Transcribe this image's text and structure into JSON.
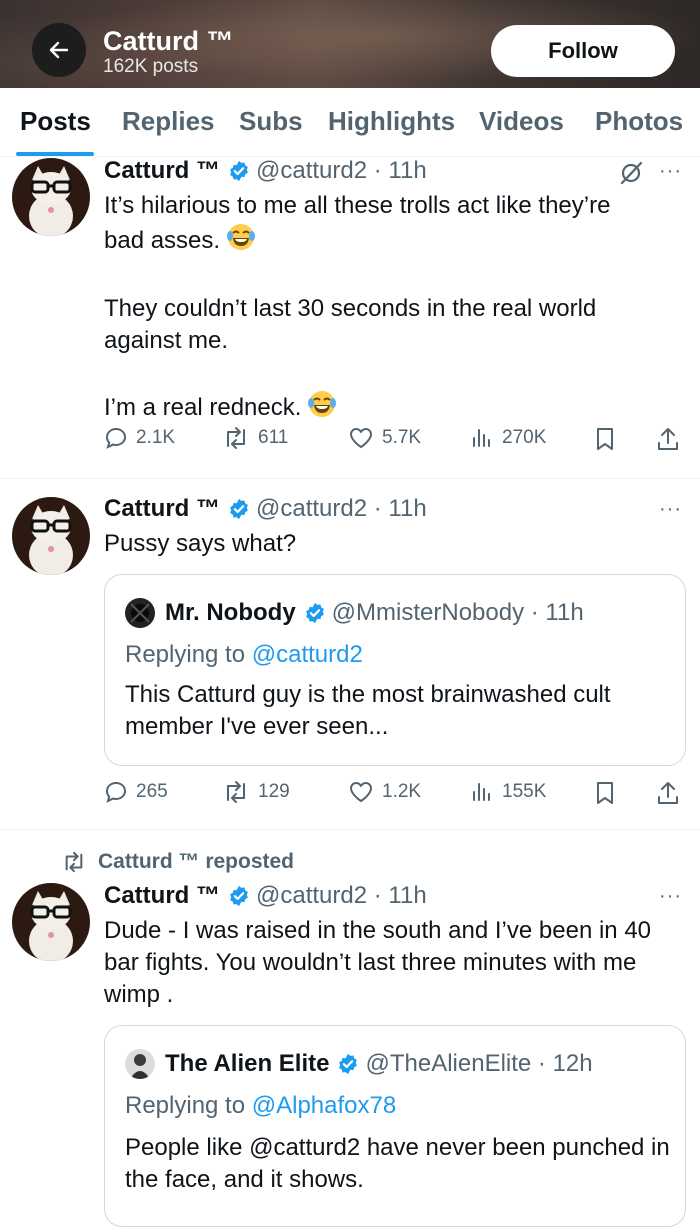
{
  "header": {
    "title": "Catturd ™",
    "post_count": "162K posts",
    "follow_label": "Follow"
  },
  "tabs": [
    "Posts",
    "Replies",
    "Subs",
    "Highlights",
    "Videos",
    "Photos"
  ],
  "active_tab": "Posts",
  "posts": [
    {
      "name": "Catturd ™",
      "handle": "@catturd2 · 11h",
      "body_lines": [
        "It’s hilarious to me all these trolls act like they’re",
        "bad asses.",
        "They couldn’t last 30 seconds in the real world",
        "against me.",
        "I’m a real redneck."
      ],
      "emoji": "😂",
      "replies": "2.1K",
      "reposts": "611",
      "likes": "5.7K",
      "views": "270K"
    },
    {
      "name": "Catturd ™",
      "handle": "@catturd2 · 11h",
      "body": "Pussy says what?",
      "quote": {
        "name": "Mr. Nobody",
        "handle": "@MmisterNobody · 11h",
        "replying_prefix": "Replying to ",
        "replying_to": "@catturd2",
        "text": "This Catturd guy is the most brainwashed cult member I've ever seen..."
      },
      "replies": "265",
      "reposts": "129",
      "likes": "1.2K",
      "views": "155K"
    },
    {
      "repost_label": "Catturd ™ reposted",
      "name": "Catturd ™",
      "handle": "@catturd2 · 11h",
      "body": "Dude - I was raised in the south and I’ve been in 40 bar fights. You wouldn’t last three minutes with me wimp .",
      "quote": {
        "name": "The Alien Elite",
        "handle": "@TheAlienElite · 12h",
        "replying_prefix": "Replying to ",
        "replying_to": "@Alphafox78",
        "text": "People like @catturd2 have never been punched in the face, and it shows."
      }
    }
  ],
  "more_label": "···",
  "colors": {
    "accent": "#1d9bf0",
    "text": "#0f1419",
    "muted": "#536471",
    "border": "#cfd9de"
  }
}
